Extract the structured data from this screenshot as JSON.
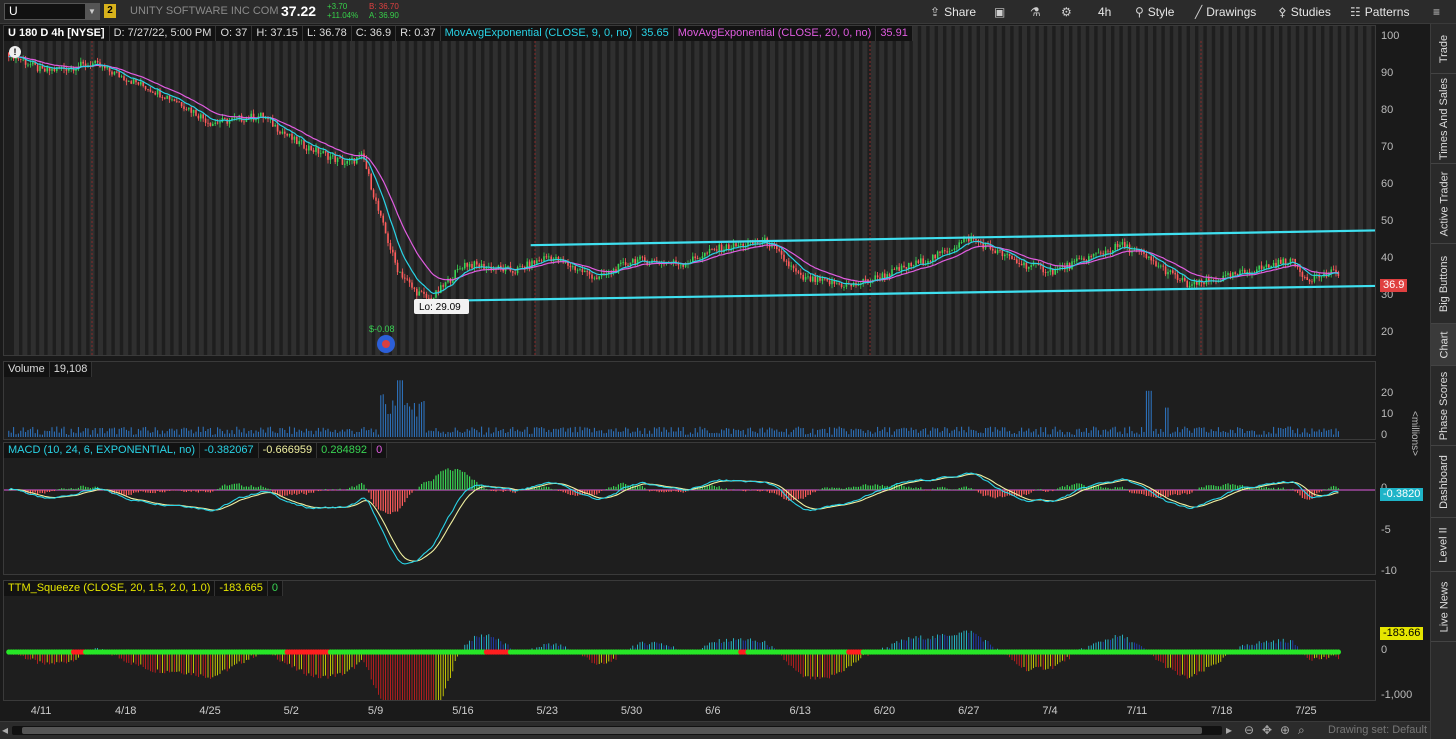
{
  "toolbar": {
    "symbol": "U",
    "link_number": "2",
    "company": "UNITY SOFTWARE INC COM",
    "last": "37.22",
    "change": "+3.70",
    "change_pct": "+11.04%",
    "bid": "B: 36.70",
    "ask": "A: 36.90",
    "share": "Share",
    "timeframe": "4h",
    "style": "Style",
    "drawings": "Drawings",
    "studies": "Studies",
    "patterns": "Patterns"
  },
  "price_pane": {
    "title": "U 180 D 4h [NYSE]",
    "date": "D: 7/27/22, 5:00 PM",
    "open": "O: 37",
    "high": "H: 37.15",
    "low": "L: 36.78",
    "close": "C: 36.9",
    "range": "R: 0.37",
    "ema9_label": "MovAvgExponential (CLOSE, 9, 0, no)",
    "ema9_value": "35.65",
    "ema20_label": "MovAvgExponential (CLOSE, 20, 0, no)",
    "ema20_value": "35.91",
    "low_bubble": "Lo: 29.09",
    "earnings_marker": "$-0.08",
    "price_tag": "36.9",
    "y_ticks": [
      "100",
      "90",
      "80",
      "70",
      "60",
      "50",
      "40",
      "30",
      "20"
    ]
  },
  "volume_pane": {
    "title": "Volume",
    "value": "19,108",
    "y_ticks": [
      "20",
      "10",
      "0"
    ],
    "unit_label": "<millions>"
  },
  "macd_pane": {
    "title": "MACD (10, 24, 6, EXPONENTIAL, no)",
    "value": "-0.382067",
    "avg": "-0.666959",
    "diff": "0.284892",
    "zero": "0",
    "y_ticks": [
      "0",
      "-5",
      "-10"
    ],
    "tag": "-0.3820"
  },
  "squeeze_pane": {
    "title": "TTM_Squeeze (CLOSE, 20, 1.5, 2.0, 1.0)",
    "value": "-183.665",
    "zero": "0",
    "y_ticks": [
      "0",
      "-1,000"
    ],
    "tag": "-183.66"
  },
  "x_axis": [
    "4/11",
    "4/18",
    "4/25",
    "5/2",
    "5/9",
    "5/16",
    "5/23",
    "5/30",
    "6/6",
    "6/13",
    "6/20",
    "6/27",
    "7/4",
    "7/11",
    "7/18",
    "7/25"
  ],
  "side_tabs": [
    "Trade",
    "Times And Sales",
    "Active Trader",
    "Big Buttons",
    "Chart",
    "Phase Scores",
    "Dashboard",
    "Level II",
    "Live News"
  ],
  "bottom": {
    "drawing_set": "Drawing set: Default"
  },
  "colors": {
    "candle_up": "#39d353",
    "candle_down": "#ff5c5c",
    "ema9": "#29d3e6",
    "ema20": "#e05ce0",
    "trendline": "#3fe0f0",
    "squeeze_on": "#ff1f1f",
    "squeeze_off": "#27e627"
  },
  "chart_data": {
    "type": "candlestick",
    "symbol": "U",
    "interval": "4h",
    "x_labels": [
      "4/11",
      "4/18",
      "4/25",
      "5/2",
      "5/9",
      "5/16",
      "5/23",
      "5/30",
      "6/6",
      "6/13",
      "6/20",
      "6/27",
      "7/4",
      "7/11",
      "7/18",
      "7/25"
    ],
    "close_path": [
      [
        "4/7",
        96
      ],
      [
        "4/11",
        91
      ],
      [
        "4/14",
        93
      ],
      [
        "4/18",
        89
      ],
      [
        "4/21",
        83
      ],
      [
        "4/25",
        77
      ],
      [
        "4/28",
        79
      ],
      [
        "5/2",
        72
      ],
      [
        "5/5",
        66
      ],
      [
        "5/6",
        68
      ],
      [
        "5/9",
        52
      ],
      [
        "5/10",
        38
      ],
      [
        "5/11",
        32
      ],
      [
        "5/12",
        29.1
      ],
      [
        "5/13",
        34
      ],
      [
        "5/16",
        39
      ],
      [
        "5/19",
        37
      ],
      [
        "5/23",
        41
      ],
      [
        "5/26",
        35
      ],
      [
        "5/30",
        40
      ],
      [
        "6/2",
        39
      ],
      [
        "6/6",
        43
      ],
      [
        "6/9",
        45
      ],
      [
        "6/13",
        35
      ],
      [
        "6/16",
        33
      ],
      [
        "6/20",
        36
      ],
      [
        "6/23",
        41
      ],
      [
        "6/27",
        46
      ],
      [
        "6/30",
        39
      ],
      [
        "7/4",
        37
      ],
      [
        "7/8",
        44
      ],
      [
        "7/11",
        42
      ],
      [
        "7/14",
        33
      ],
      [
        "7/18",
        35
      ],
      [
        "7/22",
        40
      ],
      [
        "7/25",
        35
      ],
      [
        "7/27",
        36.9
      ]
    ],
    "trendlines": [
      {
        "name": "upper",
        "from": [
          "5/20",
          44
        ],
        "to": [
          "7/29",
          48
        ]
      },
      {
        "name": "lower",
        "from": [
          "5/13",
          29
        ],
        "to": [
          "7/29",
          33
        ]
      }
    ],
    "y_range": [
      20,
      100
    ]
  }
}
